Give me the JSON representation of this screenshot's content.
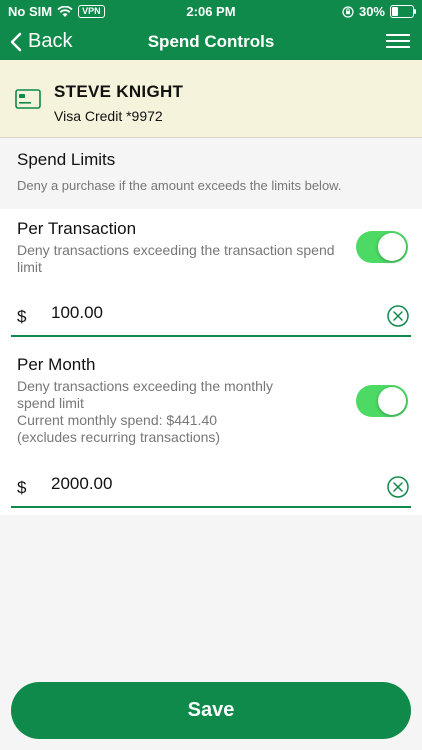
{
  "status_bar": {
    "carrier": "No SIM",
    "vpn": "VPN",
    "time": "2:06 PM",
    "battery": "30%"
  },
  "nav": {
    "back_label": "Back",
    "title": "Spend Controls"
  },
  "card": {
    "holder": "STEVE KNIGHT",
    "name": "Visa Credit *9972"
  },
  "spend_limits": {
    "title": "Spend Limits",
    "description": "Deny a purchase if the amount exceeds the limits below."
  },
  "per_transaction": {
    "title": "Per Transaction",
    "description": "Deny transactions exceeding the transaction spend limit",
    "enabled": true,
    "currency": "$",
    "amount": "100.00"
  },
  "per_month": {
    "title": "Per Month",
    "description": "Deny transactions exceeding the monthly spend limit",
    "current_spend": "Current monthly spend: $441.40",
    "excludes_note": "(excludes recurring transactions)",
    "enabled": true,
    "currency": "$",
    "amount": "2000.00"
  },
  "save_label": "Save",
  "colors": {
    "brand": "#0f8a4a",
    "toggle_on": "#4cd964",
    "card_bg": "#f5f3dc"
  },
  "icons": [
    "wifi-icon",
    "vpn-badge",
    "orientation-lock-icon",
    "battery-icon",
    "chevron-left-icon",
    "hamburger-menu-icon",
    "credit-card-icon",
    "clear-circle-icon"
  ]
}
